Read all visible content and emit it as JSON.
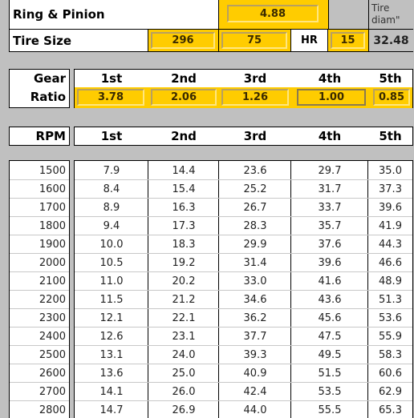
{
  "header": {
    "ring_pinion_label": "Ring & Pinion",
    "ring_pinion_value": "4.88",
    "tire_size_label": "Tire Size",
    "tire_width": "296",
    "tire_aspect": "75",
    "tire_type": "HR",
    "rim_diameter": "15",
    "tire_diam_label_line1": "Tire",
    "tire_diam_label_line2": "diam\"",
    "tire_diam_value": "32.48"
  },
  "gears": {
    "label_line1": "Gear",
    "label_line2": "Ratio",
    "columns": [
      "1st",
      "2nd",
      "3rd",
      "4th",
      "5th"
    ],
    "ratios": [
      "3.78",
      "2.06",
      "1.26",
      "1.00",
      "0.85"
    ]
  },
  "speed_table": {
    "rpm_header": "RPM",
    "columns": [
      "1st",
      "2nd",
      "3rd",
      "4th",
      "5th"
    ],
    "rows": [
      {
        "rpm": "1500",
        "speeds": [
          "7.9",
          "14.4",
          "23.6",
          "29.7",
          "35.0"
        ]
      },
      {
        "rpm": "1600",
        "speeds": [
          "8.4",
          "15.4",
          "25.2",
          "31.7",
          "37.3"
        ]
      },
      {
        "rpm": "1700",
        "speeds": [
          "8.9",
          "16.3",
          "26.7",
          "33.7",
          "39.6"
        ]
      },
      {
        "rpm": "1800",
        "speeds": [
          "9.4",
          "17.3",
          "28.3",
          "35.7",
          "41.9"
        ]
      },
      {
        "rpm": "1900",
        "speeds": [
          "10.0",
          "18.3",
          "29.9",
          "37.6",
          "44.3"
        ]
      },
      {
        "rpm": "2000",
        "speeds": [
          "10.5",
          "19.2",
          "31.4",
          "39.6",
          "46.6"
        ]
      },
      {
        "rpm": "2100",
        "speeds": [
          "11.0",
          "20.2",
          "33.0",
          "41.6",
          "48.9"
        ]
      },
      {
        "rpm": "2200",
        "speeds": [
          "11.5",
          "21.2",
          "34.6",
          "43.6",
          "51.3"
        ]
      },
      {
        "rpm": "2300",
        "speeds": [
          "12.1",
          "22.1",
          "36.2",
          "45.6",
          "53.6"
        ]
      },
      {
        "rpm": "2400",
        "speeds": [
          "12.6",
          "23.1",
          "37.7",
          "47.5",
          "55.9"
        ]
      },
      {
        "rpm": "2500",
        "speeds": [
          "13.1",
          "24.0",
          "39.3",
          "49.5",
          "58.3"
        ]
      },
      {
        "rpm": "2600",
        "speeds": [
          "13.6",
          "25.0",
          "40.9",
          "51.5",
          "60.6"
        ]
      },
      {
        "rpm": "2700",
        "speeds": [
          "14.1",
          "26.0",
          "42.4",
          "53.5",
          "62.9"
        ]
      },
      {
        "rpm": "2800",
        "speeds": [
          "14.7",
          "26.9",
          "44.0",
          "55.5",
          "65.3"
        ]
      }
    ]
  },
  "colors": {
    "input_fill": "#ffcc00",
    "background": "#c0c0c0"
  }
}
